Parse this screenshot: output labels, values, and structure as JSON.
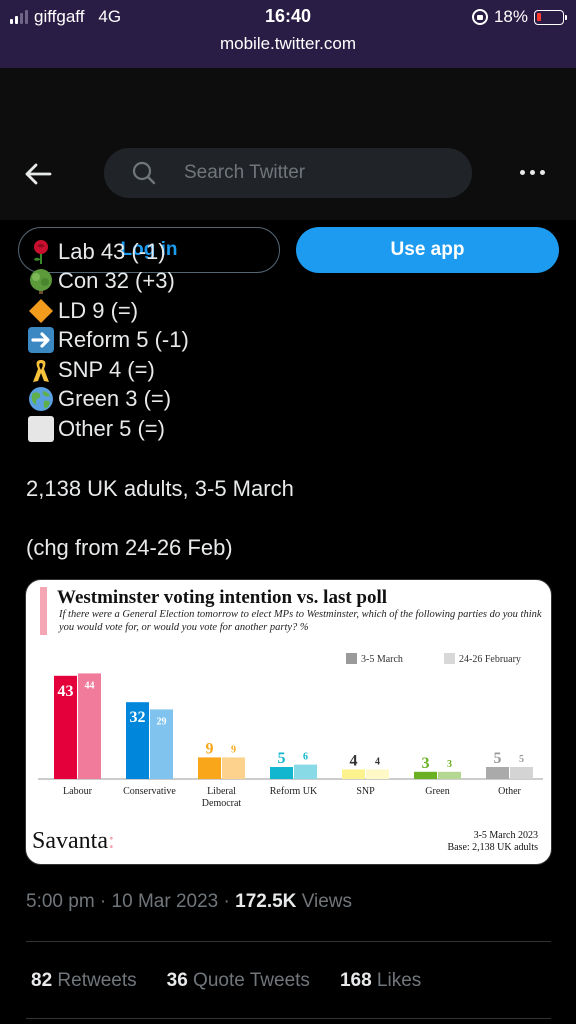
{
  "status_bar": {
    "carrier": "giffgaff",
    "network": "4G",
    "time": "16:40",
    "battery": "18%",
    "battery_level": 0.18,
    "url": "mobile.twitter.com"
  },
  "header": {
    "search_placeholder": "Search Twitter",
    "login_label": "Log in",
    "use_app_label": "Use app"
  },
  "tweet": {
    "lines": [
      {
        "icon": "rose-icon",
        "text": "Lab 43 (-1)"
      },
      {
        "icon": "tree-icon",
        "text": "Con 32 (+3)"
      },
      {
        "icon": "diamond-icon",
        "text": "LD 9 (=)"
      },
      {
        "icon": "arrow-right-icon",
        "text": "Reform 5 (-1)"
      },
      {
        "icon": "ribbon-icon",
        "text": "SNP 4 (=)"
      },
      {
        "icon": "globe-icon",
        "text": "Green 3 (=)"
      },
      {
        "icon": "white-square-icon",
        "text": "Other 5 (=)"
      }
    ],
    "sample": "2,138 UK adults, 3-5 March",
    "change": "(chg from 24-26 Feb)"
  },
  "chart_card": {
    "title": "Westminster voting intention vs. last poll",
    "subtitle": "If there were a General Election tomorrow to elect MPs to Westminster, which of the following parties do you think you would vote for, or would you vote for another party? %",
    "brand": "Savanta",
    "brand_colon": ":",
    "footnote_date": "3-5 March 2023",
    "footnote_base": "Base: 2,138 UK adults"
  },
  "chart_data": {
    "type": "bar",
    "categories": [
      "Labour",
      "Conservative",
      "Liberal Democrat",
      "Reform UK",
      "SNP",
      "Green",
      "Other"
    ],
    "series": [
      {
        "name": "3-5 March",
        "values": [
          43,
          32,
          9,
          5,
          4,
          3,
          5
        ]
      },
      {
        "name": "24-26 February",
        "values": [
          44,
          29,
          9,
          6,
          4,
          3,
          5
        ]
      }
    ],
    "colors": {
      "current": [
        "#e4003b",
        "#0087dc",
        "#faa61a",
        "#12b6cf",
        "#fdf38e",
        "#6ab023",
        "#aaaaaa"
      ],
      "previous": [
        "#f07b9a",
        "#7fc3ee",
        "#fcd28c",
        "#88dae7",
        "#fef9c6",
        "#b4d791",
        "#d4d4d4"
      ],
      "labels_current": [
        "#ffffff",
        "#ffffff",
        "#faa61a",
        "#12b6cf",
        "#333333",
        "#6ab023",
        "#999999"
      ],
      "labels_previous": [
        "#ffffff",
        "#ffffff",
        "#faa61a",
        "#12b6cf",
        "#333333",
        "#6ab023",
        "#999999"
      ]
    },
    "ylim": [
      0,
      50
    ],
    "legend_position": "top-right",
    "grid": false
  },
  "meta": {
    "time": "5:00 pm",
    "date": "10 Mar 2023",
    "views_count": "172.5K",
    "views_label": "Views"
  },
  "stats": {
    "retweets": "82",
    "retweets_label": "Retweets",
    "quotes": "36",
    "quotes_label": "Quote Tweets",
    "likes": "168",
    "likes_label": "Likes"
  }
}
